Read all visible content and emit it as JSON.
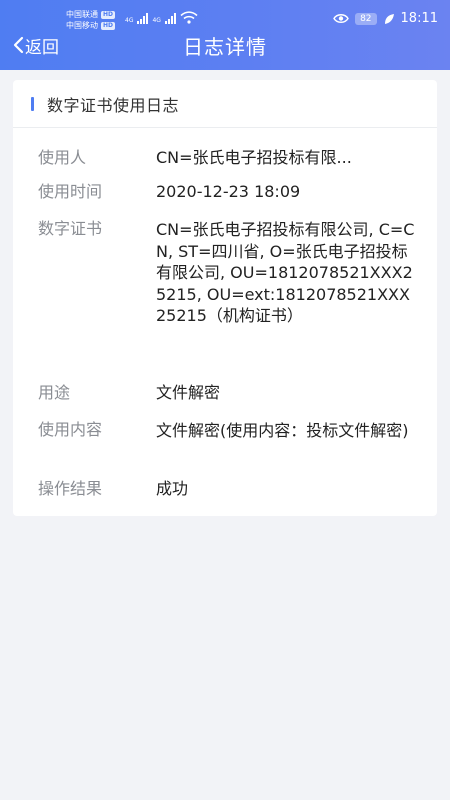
{
  "status_bar": {
    "carrier1": "中国联通",
    "carrier2": "中国移动",
    "hd": "HD",
    "net1": "4G",
    "net2": "4G",
    "battery": "82",
    "time": "18:11"
  },
  "header": {
    "back_label": "返回",
    "title": "日志详情"
  },
  "card": {
    "title": "数字证书使用日志",
    "fields": [
      {
        "label": "使用人",
        "value": "CN=张氏电子招投标有限..."
      },
      {
        "label": "使用时间",
        "value": "2020-12-23 18:09"
      },
      {
        "label": "数字证书",
        "value": "CN=张氏电子招投标有限公司, C=CN, ST=四川省, O=张氏电子招投标有限公司, OU=1812078521XXX25215, OU=ext:1812078521XXX25215（机构证书）"
      },
      {
        "label": "用途",
        "value": "文件解密"
      },
      {
        "label": "使用内容",
        "value": "文件解密(使用内容：投标文件解密)"
      },
      {
        "label": "操作结果",
        "value": "成功"
      }
    ]
  },
  "colors": {
    "accent": "#4f7df2",
    "background": "#f2f3f7"
  }
}
